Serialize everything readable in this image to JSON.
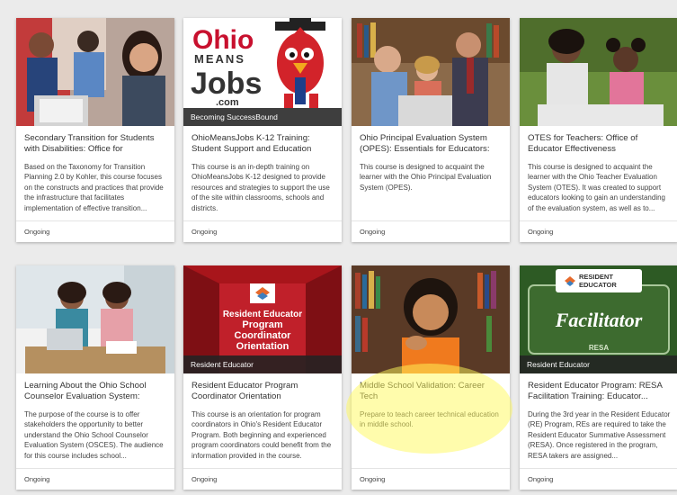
{
  "courses": [
    {
      "title": "Secondary Transition for Students with Disabilities: Office for",
      "description": "Based on the Taxonomy for Transition Planning 2.0 by Kohler, this course focuses on the constructs and practices that provide the infrastructure that facilitates implementation of effective transition...",
      "status": "Ongoing",
      "category": ""
    },
    {
      "title": "OhioMeansJobs K-12 Training: Student Support and Education",
      "description": "This course is an in-depth training on OhioMeansJobs K-12 designed to provide resources and strategies to support the use of the site within classrooms, schools and districts.",
      "status": "Ongoing",
      "category": "Becoming SuccessBound",
      "logo": {
        "line1": "Ohio",
        "line2": "MEANS",
        "line3": "Jobs",
        "line4": ".com"
      }
    },
    {
      "title": "Ohio Principal Evaluation System (OPES): Essentials for Educators:",
      "description": "This course is designed to acquaint the learner with the Ohio Principal Evaluation System (OPES).",
      "status": "Ongoing",
      "category": ""
    },
    {
      "title": "OTES for Teachers: Office of Educator Effectiveness",
      "description": "This course is designed to acquaint the learner with the Ohio Teacher Evaluation System (OTES). It was created to support educators looking to gain an understanding of the evaluation system, as well as to...",
      "status": "Ongoing",
      "category": ""
    },
    {
      "title": "Learning About the Ohio School Counselor Evaluation System:",
      "description": "The purpose of the course is to offer stakeholders the opportunity to better understand the Ohio School Counselor Evaluation System (OSCES). The audience for this course includes school...",
      "status": "Ongoing",
      "category": ""
    },
    {
      "title": "Resident Educator Program Coordinator Orientation",
      "description": "This course is an orientation for program coordinators in Ohio's Resident Educator Program. Both beginning and experienced program coordinators could benefit from the information provided in the course.",
      "status": "Ongoing",
      "category": "Resident Educator",
      "banner": {
        "line1": "Resident Educator",
        "line2": "Program",
        "line3": "Coordinator",
        "line4": "Orientation"
      }
    },
    {
      "title": "Middle School Validation: Career Tech",
      "description": "Prepare to teach career technical education in middle school.",
      "status": "Ongoing",
      "category": ""
    },
    {
      "title": "Resident Educator Program: RESA Facilitation Training: Educator...",
      "description": "During the 3rd year in the Resident Educator (RE) Program, REs are required to take the Resident Educator Summative Assessment (RESA). Once registered in the program, RESA takers are assigned...",
      "status": "Ongoing",
      "category": "Resident Educator",
      "badge": {
        "top1": "RESIDENT",
        "top2": "EDUCATOR",
        "main": "Facilitator",
        "bottom": "RESA"
      }
    }
  ],
  "colors": {
    "page_bg": "#ebebeb",
    "card_bg": "#ffffff",
    "ohio_red": "#c8102e",
    "banner_red": "#a8151b",
    "badge_green": "#3d6b2f",
    "highlight": "#fffa5a"
  }
}
